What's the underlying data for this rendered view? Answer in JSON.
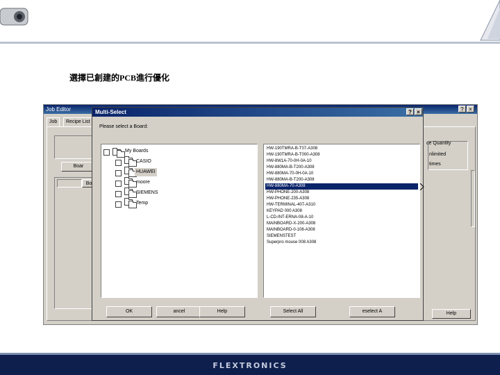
{
  "caption": "選擇已創建的PCB進行優化",
  "job_editor": {
    "title": "Job Editor",
    "title_buttons": [
      "?",
      "×"
    ],
    "tabs": [
      "Job",
      "Recipe List"
    ],
    "button_partial": "Boar",
    "cell_partial": "Bo",
    "quantity_label": "ce Quantity",
    "unlimited_text": "nlimited",
    "times_text": "times",
    "help_label": "Help"
  },
  "dialog": {
    "title": "Multi-Select",
    "title_buttons": [
      "?",
      "×"
    ],
    "prompt": "Please select a Board:",
    "tree": [
      {
        "label": "My Boards",
        "selected": false
      },
      {
        "label": "CASIO",
        "selected": false
      },
      {
        "label": "HUAWEI",
        "selected": true
      },
      {
        "label": "moore",
        "selected": false
      },
      {
        "label": "SIEMENS",
        "selected": false
      },
      {
        "label": "Temp",
        "selected": false
      }
    ],
    "boards": [
      {
        "label": "HW-190TMRA-B-T07-A308",
        "selected": false
      },
      {
        "label": "HW-190TMRA-B-T000-A308",
        "selected": false
      },
      {
        "label": "HW-8W1A-70-0H-0A-10",
        "selected": false
      },
      {
        "label": "HW-880MA-B-T200-A308",
        "selected": false
      },
      {
        "label": "HW-880MA-70-0H-0A-10",
        "selected": false
      },
      {
        "label": "HW-880MA-B-T200-A308",
        "selected": false
      },
      {
        "label": "HW-880MA-70-A308",
        "selected": true
      },
      {
        "label": "HW-PHONE-200-A308",
        "selected": false
      },
      {
        "label": "HW-PHONE-235-A308",
        "selected": false
      },
      {
        "label": "HW-TERMINAL-407-A310",
        "selected": false
      },
      {
        "label": "KEYPAD 000 A308",
        "selected": false
      },
      {
        "label": "L-CD-INT-ERNA-08-A-10",
        "selected": false
      },
      {
        "label": "MAINBOARD-X-200-A308",
        "selected": false
      },
      {
        "label": "MAINBOARD-0-108-A308",
        "selected": false
      },
      {
        "label": "SIEMENSTEST",
        "selected": false
      },
      {
        "label": "Superpro mouse 008 A308",
        "selected": false
      }
    ],
    "buttons": {
      "ok": "OK",
      "cancel": "ancel",
      "help": "Help",
      "select_all": "Select All",
      "deselect_all": "eselect A"
    }
  },
  "footer": {
    "brand": "FLEXTRONICS"
  }
}
